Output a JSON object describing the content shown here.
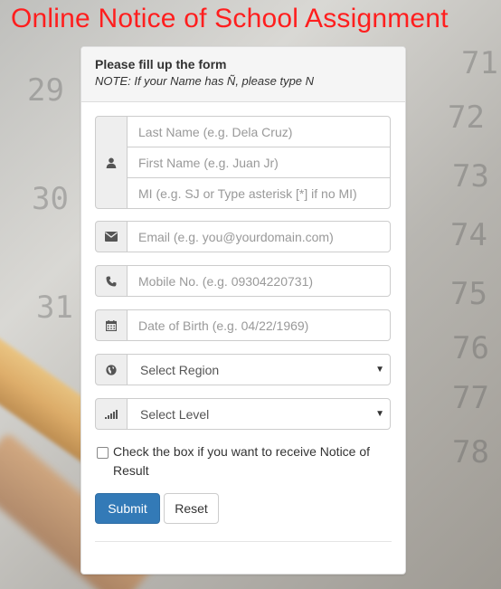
{
  "page": {
    "title": "Online Notice of School Assignment",
    "title_color": "#ff1e1e"
  },
  "form": {
    "heading": "Please fill up the form",
    "note": "NOTE: If your Name has Ñ, please type N",
    "name_icon": "user-icon",
    "last_name_placeholder": "Last Name   (e.g. Dela Cruz)",
    "first_name_placeholder": "First Name   (e.g. Juan Jr)",
    "mi_placeholder": "MI  (e.g. SJ or Type asterisk [*] if no MI)",
    "email_icon": "envelope-icon",
    "email_placeholder": "Email  (e.g. you@yourdomain.com)",
    "mobile_icon": "phone-icon",
    "mobile_placeholder": "Mobile No.  (e.g. 09304220731)",
    "dob_icon": "calendar-icon",
    "dob_placeholder": "Date of Birth  (e.g.  04/22/1969)",
    "region_icon": "globe-icon",
    "region_selected": "Select Region",
    "level_icon": "signal-icon",
    "level_selected": "Select Level",
    "checkbox_label": "Check the box if you want to receive Notice of Result",
    "submit_label": "Submit",
    "reset_label": "Reset",
    "primary_color": "#337ab7"
  }
}
